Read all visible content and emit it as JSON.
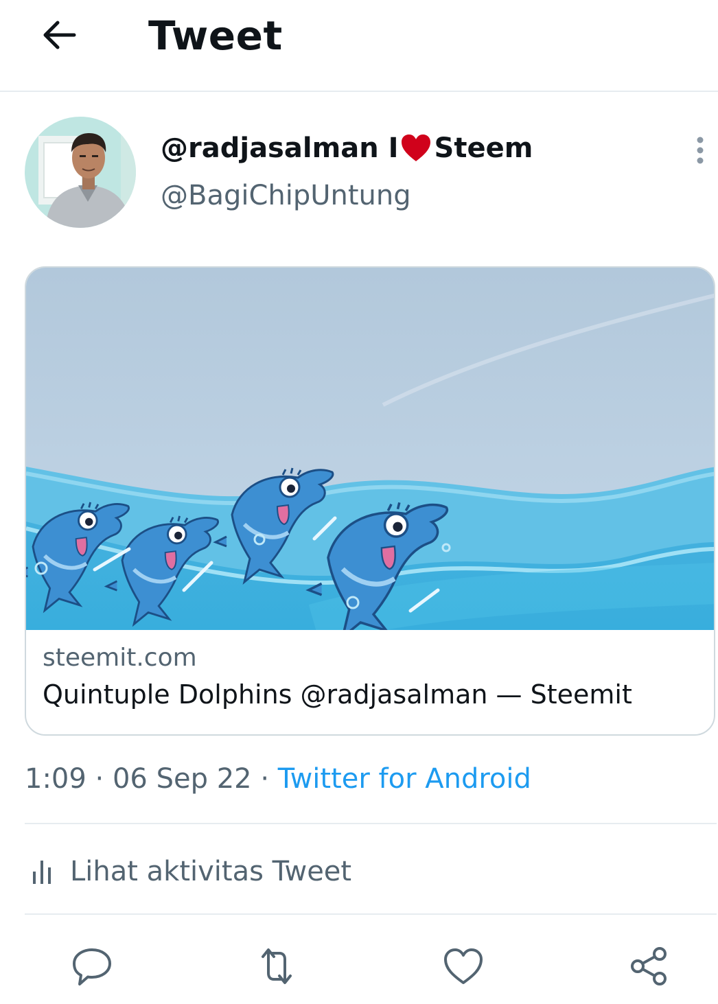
{
  "header": {
    "title": "Tweet",
    "back_icon": "arrow-left-icon"
  },
  "author": {
    "display_name": "@radjasalman I",
    "display_name_suffix": "Steem",
    "handle": "@BagiChipUntung",
    "heart_icon": "red-heart-icon",
    "more_icon": "more-vertical-icon"
  },
  "link_card": {
    "domain": "steemit.com",
    "title": "Quintuple Dolphins @radjasalman — Steemit"
  },
  "meta": {
    "time": "1:09",
    "separator": " · ",
    "date": "06 Sep 22",
    "source": "Twitter for Android"
  },
  "activity": {
    "label": "Lihat aktivitas Tweet",
    "icon": "bar-chart-icon"
  },
  "actions": [
    {
      "icon": "reply-icon"
    },
    {
      "icon": "retweet-icon"
    },
    {
      "icon": "like-icon"
    },
    {
      "icon": "share-icon"
    }
  ],
  "colors": {
    "text": "#0f1419",
    "secondary": "#536471",
    "link": "#1d9bf0",
    "heart": "#d0021b",
    "border": "#cfd9de"
  }
}
